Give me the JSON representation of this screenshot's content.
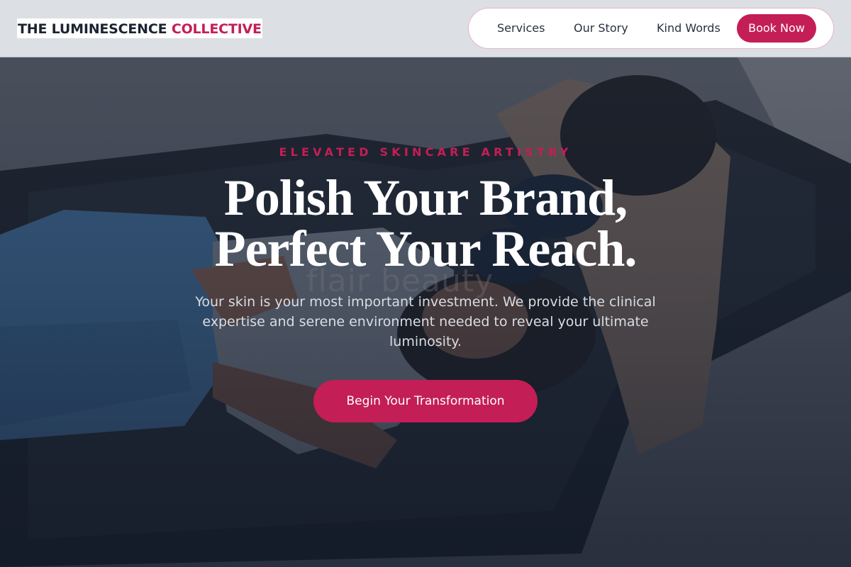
{
  "header": {
    "brand_main": "THE LUMINESCENCE",
    "brand_accent": "COLLECTIVE",
    "nav": {
      "services": "Services",
      "story": "Our Story",
      "words": "Kind Words",
      "book": "Book Now"
    }
  },
  "hero": {
    "eyebrow": "ELEVATED SKINCARE ARTISTRY",
    "headline_line1": "Polish Your Brand,",
    "headline_line2": "Perfect Your Reach.",
    "subcopy": "Your skin is your most important investment. We provide the clinical expertise and serene environment needed to reveal your ultimate luminosity.",
    "cta_label": "Begin Your Transformation",
    "wall_sign": "flair beauty"
  },
  "colors": {
    "accent": "#c41e56",
    "header_bg": "#dcdfe3",
    "brand_text": "#1c2333",
    "hero_overlay": "#1e2838"
  }
}
